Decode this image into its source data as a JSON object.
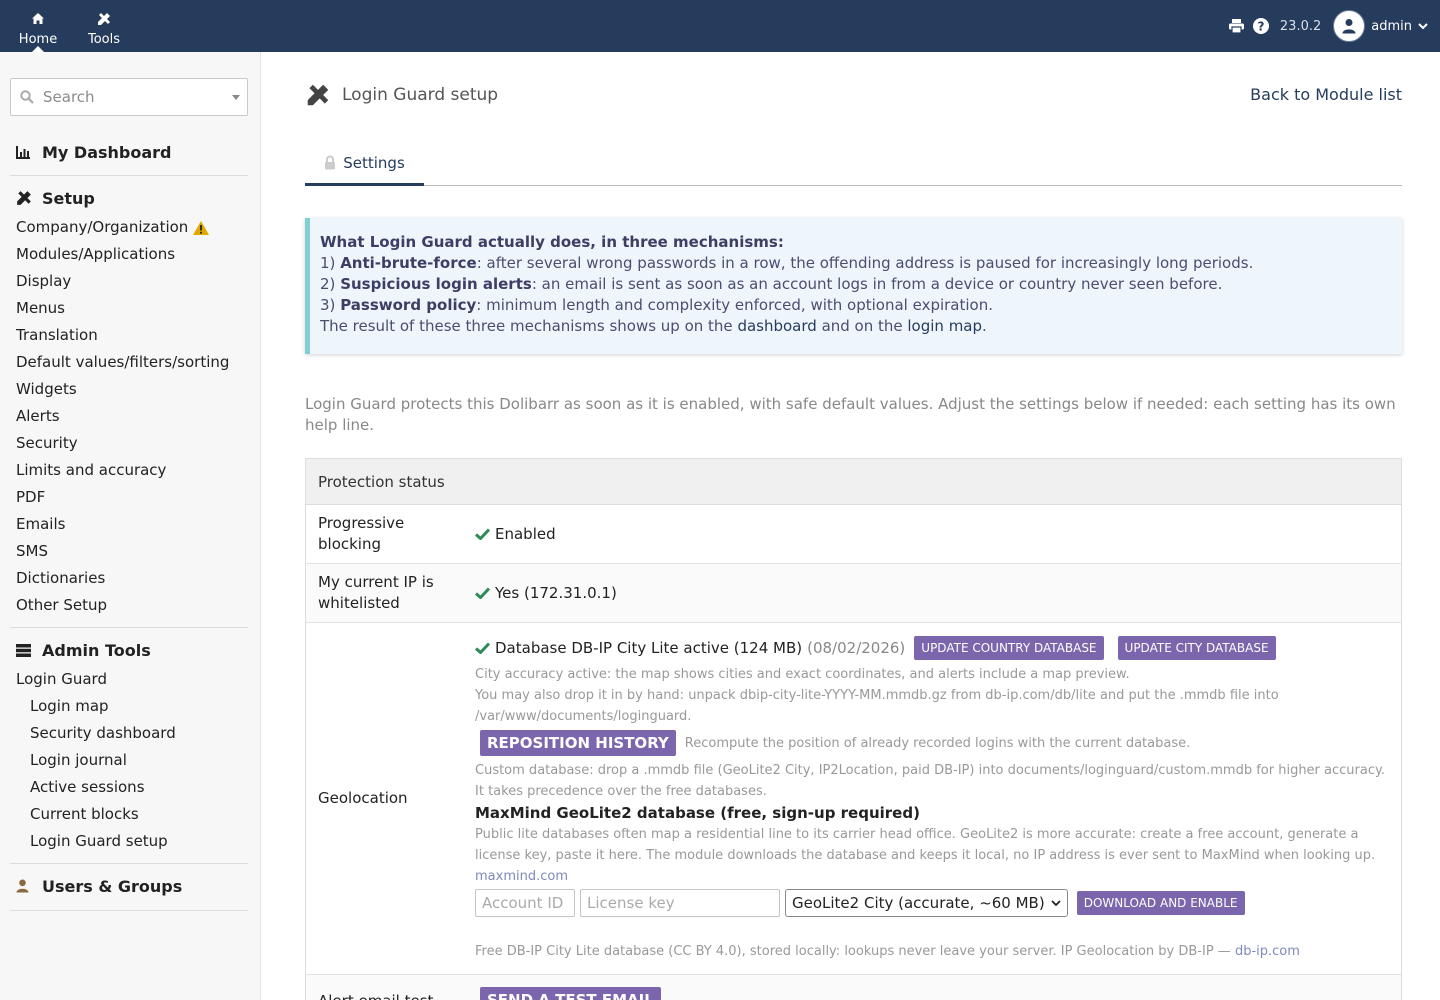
{
  "topbar": {
    "nav": [
      {
        "label": "Home",
        "icon": "home-icon"
      },
      {
        "label": "Tools",
        "icon": "tools-icon"
      }
    ],
    "version": "23.0.2",
    "user": "admin"
  },
  "sidebar": {
    "search_placeholder": "Search",
    "dashboard": "My Dashboard",
    "setup": {
      "title": "Setup",
      "items": [
        "Company/Organization",
        "Modules/Applications",
        "Display",
        "Menus",
        "Translation",
        "Default values/filters/sorting",
        "Widgets",
        "Alerts",
        "Security",
        "Limits and accuracy",
        "PDF",
        "Emails",
        "SMS",
        "Dictionaries",
        "Other Setup"
      ]
    },
    "admin_tools": {
      "title": "Admin Tools",
      "parent": "Login Guard",
      "items": [
        "Login map",
        "Security dashboard",
        "Login journal",
        "Active sessions",
        "Current blocks",
        "Login Guard setup"
      ]
    },
    "users_groups": "Users & Groups"
  },
  "page": {
    "title": "Login Guard setup",
    "back_link": "Back to Module list",
    "tab": "Settings"
  },
  "info": {
    "heading": "What Login Guard actually does, in three mechanisms:",
    "m1_num": "1)",
    "m1_bold": "Anti-brute-force",
    "m1_text": ": after several wrong passwords in a row, the offending address is paused for increasingly long periods.",
    "m2_num": "2)",
    "m2_bold": "Suspicious login alerts",
    "m2_text": ": an email is sent as soon as an account logs in from a device or country never seen before.",
    "m3_num": "3)",
    "m3_bold": "Password policy",
    "m3_text": ": minimum length and complexity enforced, with optional expiration.",
    "result_pre": "The result of these three mechanisms shows up on the ",
    "result_link1": "dashboard",
    "result_mid": " and on the ",
    "result_link2": "login map",
    "result_post": "."
  },
  "intro": "Login Guard protects this Dolibarr as soon as it is enabled, with safe default values. Adjust the settings below if needed: each setting has its own help line.",
  "table": {
    "header": "Protection status",
    "progressive": {
      "label": "Progressive blocking",
      "value": "Enabled"
    },
    "whitelist": {
      "label": "My current IP is whitelisted",
      "value": "Yes (172.31.0.1)"
    },
    "geo": {
      "label": "Geolocation",
      "db_status": "Database DB-IP City Lite active (124 MB)",
      "db_date": "(08/02/2026)",
      "btn_country": "UPDATE COUNTRY DATABASE",
      "btn_city": "UPDATE CITY DATABASE",
      "accuracy": "City accuracy active: the map shows cities and exact coordinates, and alerts include a map preview.",
      "manual": "You may also drop it in by hand: unpack dbip-city-lite-YYYY-MM.mmdb.gz from db-ip.com/db/lite and put the .mmdb file into /var/www/documents/loginguard.",
      "btn_reposition": "REPOSITION HISTORY",
      "reposition_help": "Recompute the position of already recorded logins with the current database.",
      "custom": "Custom database: drop a .mmdb file (GeoLite2 City, IP2Location, paid DB-IP) into documents/loginguard/custom.mmdb for higher accuracy. It takes precedence over the free databases.",
      "maxmind_title": "MaxMind GeoLite2 database (free, sign-up required)",
      "maxmind_help": "Public lite databases often map a residential line to its carrier head office. GeoLite2 is more accurate: create a free account, generate a license key, paste it here. The module downloads the database and keeps it local, no IP address is ever sent to MaxMind when looking up.",
      "maxmind_link": "maxmind.com",
      "account_placeholder": "Account ID",
      "license_placeholder": "License key",
      "select_value": "GeoLite2 City (accurate, ~60 MB)",
      "btn_download": "DOWNLOAD AND ENABLE",
      "footer_text": "Free DB-IP City Lite database (CC BY 4.0), stored locally: lookups never leave your server. IP Geolocation by DB-IP — ",
      "footer_link": "db-ip.com"
    },
    "alert_test": {
      "label": "Alert email test",
      "btn": "SEND A TEST EMAIL"
    }
  },
  "colors": {
    "topbar": "#263c5c",
    "button": "#7b65ad",
    "info_bg": "#eef6fc",
    "info_border": "#7fcfd4",
    "check": "#2e8b57",
    "warning": "#e0a800"
  }
}
